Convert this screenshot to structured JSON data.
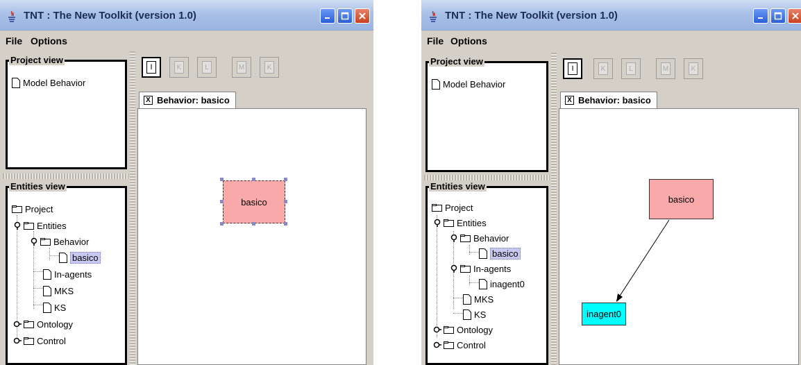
{
  "windows": [
    {
      "title": "TNT : The New Toolkit (version 1.0)",
      "menu": {
        "file": "File",
        "options": "Options"
      },
      "project_view": {
        "title": "Project view",
        "items": [
          "Model Behavior"
        ]
      },
      "entities_view": {
        "title": "Entities view",
        "tree": [
          "Project",
          "Entities",
          "Behavior",
          "basico",
          "In-agents",
          "MKS",
          "KS",
          "Ontology",
          "Control"
        ]
      },
      "toolbar": [
        "I",
        "K",
        "L",
        "M",
        "K"
      ],
      "tab": {
        "label": "Behavior: basico",
        "close": "X"
      },
      "nodes": {
        "basico": "basico"
      }
    },
    {
      "title": "TNT : The New Toolkit (version 1.0)",
      "menu": {
        "file": "File",
        "options": "Options"
      },
      "project_view": {
        "title": "Project view",
        "items": [
          "Model Behavior"
        ]
      },
      "entities_view": {
        "title": "Entities view",
        "tree": [
          "Project",
          "Entities",
          "Behavior",
          "basico",
          "In-agents",
          "inagent0",
          "MKS",
          "KS",
          "Ontology",
          "Control"
        ]
      },
      "toolbar": [
        "I",
        "K",
        "L",
        "M",
        "K"
      ],
      "tab": {
        "label": "Behavior: basico",
        "close": "X"
      },
      "nodes": {
        "basico": "basico",
        "inagent0": "inagent0"
      }
    }
  ],
  "colors": {
    "node_basico": "#f9a9a9",
    "node_inagent": "#00ffff",
    "selection": "#c8c8f0"
  }
}
